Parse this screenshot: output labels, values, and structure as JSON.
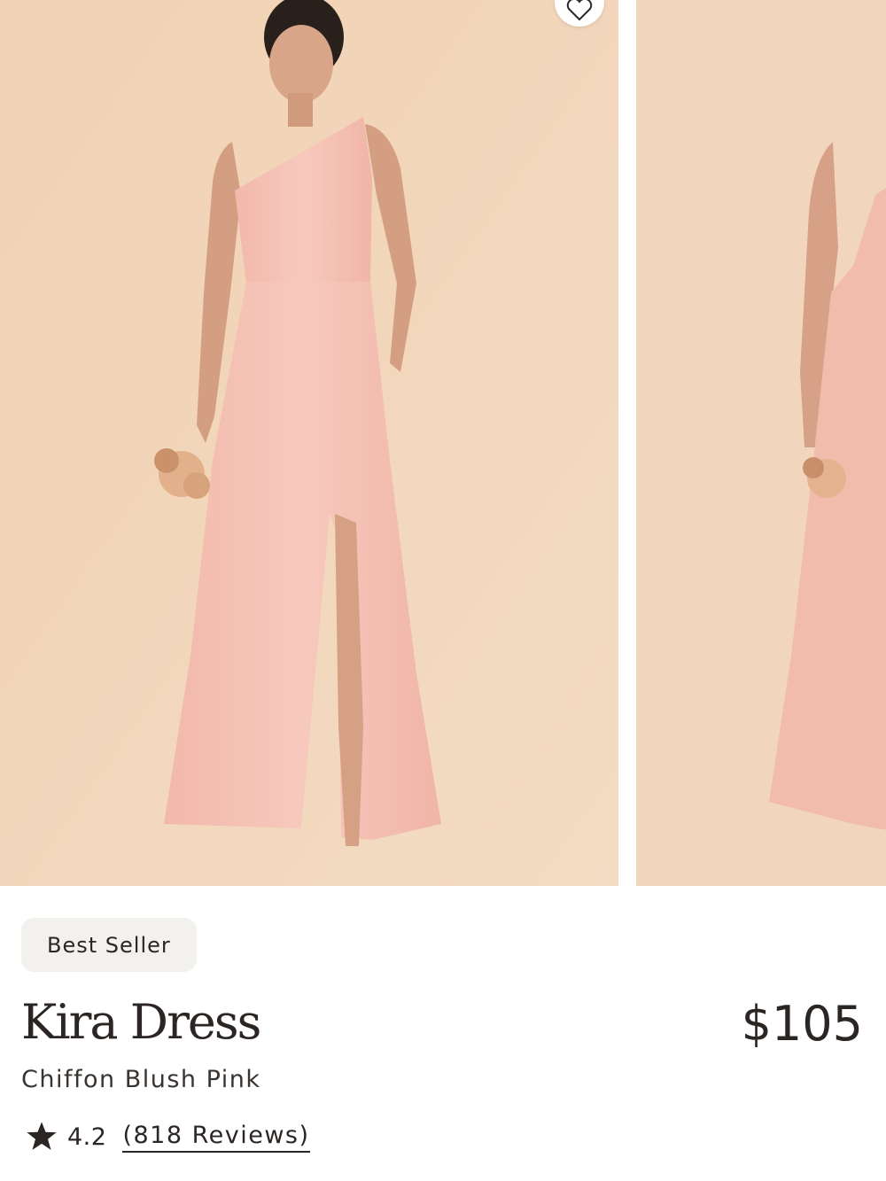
{
  "product": {
    "badge": "Best Seller",
    "name": "Kira Dress",
    "price": "$105",
    "variant": "Chiffon Blush Pink",
    "rating": "4.2",
    "reviews_label": "(818 Reviews)"
  },
  "icons": {
    "favorite": "heart-outline-icon",
    "rating": "star-icon"
  },
  "colors": {
    "backdrop": "#f1d5b8",
    "dress": "#f4c3b8",
    "text": "#2b2623",
    "badge_bg": "#f3f1ee"
  }
}
